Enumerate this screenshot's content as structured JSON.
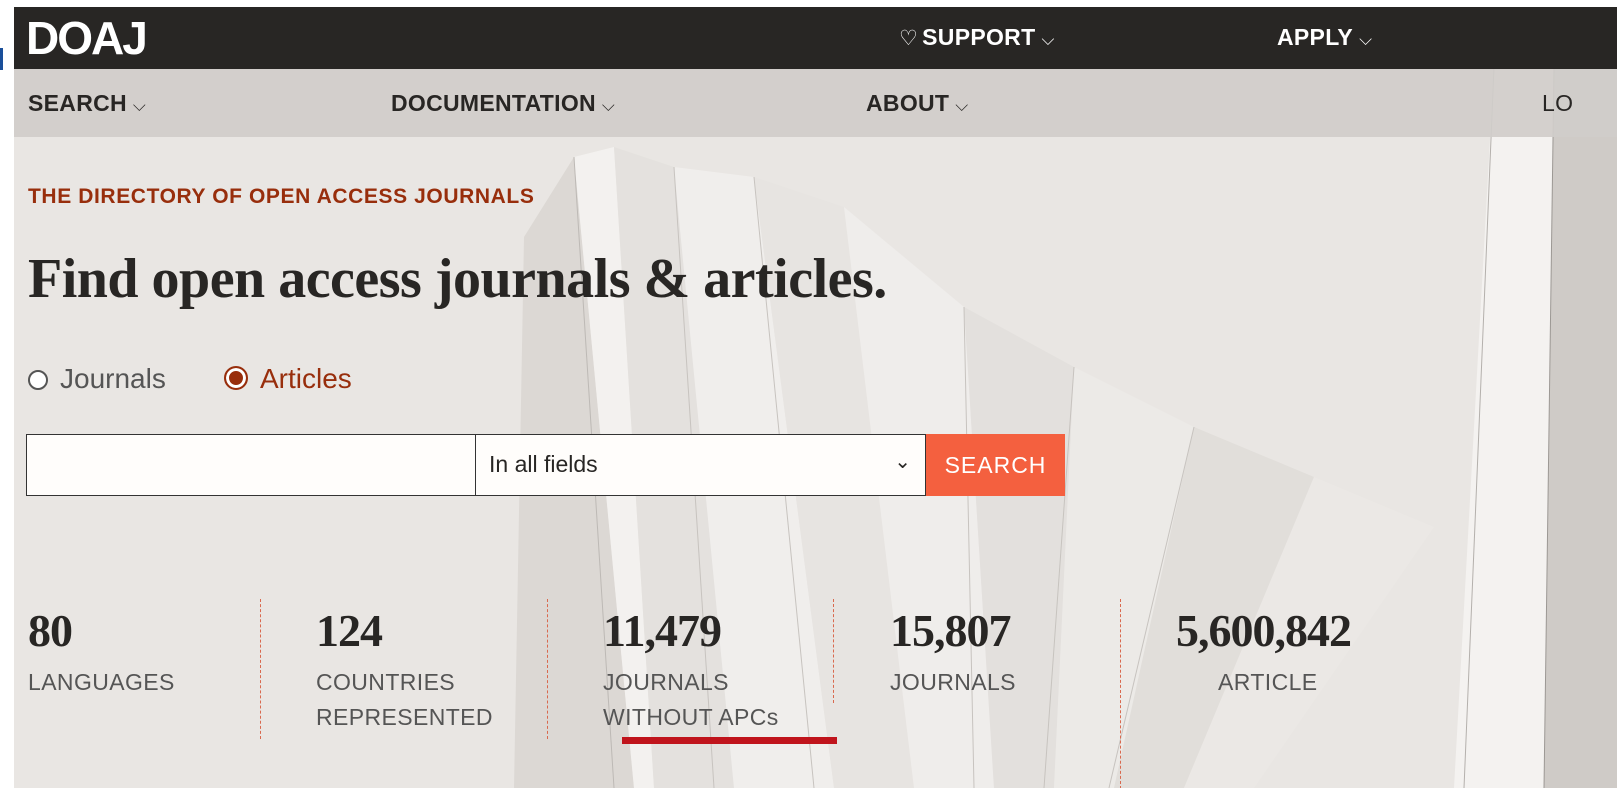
{
  "header": {
    "logo": "DOAJ",
    "nav": [
      {
        "label": "SUPPORT",
        "icon": "heart-icon"
      },
      {
        "label": "APPLY"
      }
    ]
  },
  "subnav": {
    "items": [
      "SEARCH",
      "DOCUMENTATION",
      "ABOUT"
    ],
    "right_partial": "LO"
  },
  "hero": {
    "tagline": "THE DIRECTORY OF OPEN ACCESS JOURNALS",
    "headline": "Find open access journals & articles."
  },
  "search": {
    "radio_options": [
      {
        "label": "Journals",
        "checked": false
      },
      {
        "label": "Articles",
        "checked": true
      }
    ],
    "input_value": "",
    "field_select": "In all fields",
    "button": "SEARCH"
  },
  "stats": [
    {
      "number": "80",
      "label_line1": "LANGUAGES",
      "label_line2": ""
    },
    {
      "number": "124",
      "label_line1": "COUNTRIES",
      "label_line2": "REPRESENTED"
    },
    {
      "number": "11,479",
      "label_line1": "JOURNALS",
      "label_line2": "WITHOUT APCs"
    },
    {
      "number": "15,807",
      "label_line1": "JOURNALS",
      "label_line2": ""
    },
    {
      "number": "5,600,842",
      "label_line1": "ARTICLE",
      "label_line2": ""
    }
  ],
  "colors": {
    "topbar": "#282624",
    "accent_dark": "#982e0c",
    "search_button": "#f4603f",
    "underline_annotation": "#c0141c"
  }
}
